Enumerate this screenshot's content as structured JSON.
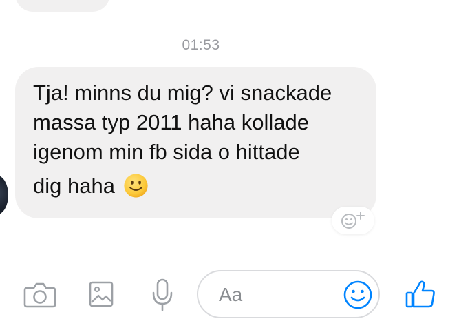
{
  "conversation": {
    "timestamp": "01:53",
    "message": {
      "lines": [
        "Tja! minns du mig? vi snackade",
        "massa typ 2011 haha kollade",
        "igenom min fb sida o hittade",
        "dig haha"
      ],
      "trailing_emoji": "slightly-smiling-face-emoji"
    },
    "reaction_button_icon": "add-reaction-icon"
  },
  "composer": {
    "camera_icon": "camera-icon",
    "gallery_icon": "image-gallery-icon",
    "mic_icon": "microphone-icon",
    "input_placeholder": "Aa",
    "emoji_icon": "smiley-icon",
    "like_icon": "thumbs-up-icon"
  },
  "colors": {
    "accent": "#0084ff",
    "bubble": "#f1f0f0",
    "timestamp": "#9a9ba0",
    "icon_gray": "#9da1a6"
  }
}
